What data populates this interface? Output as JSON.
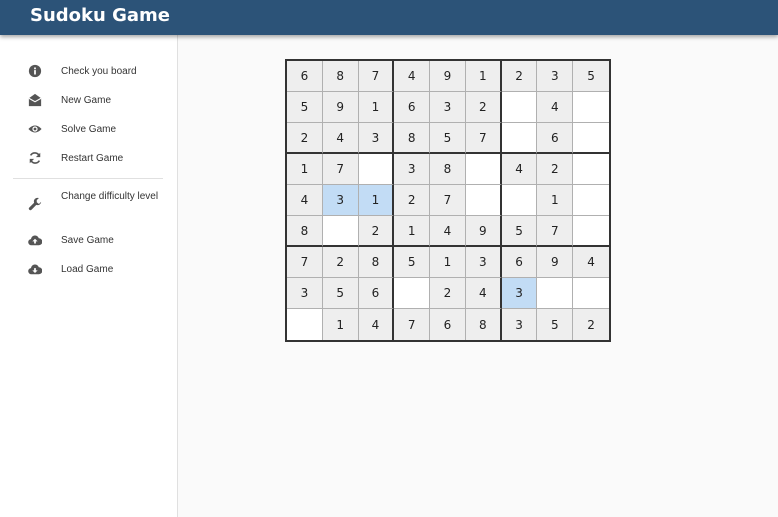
{
  "app": {
    "title": "Sudoku Game"
  },
  "sidebar": {
    "items": [
      {
        "label": "Check you board",
        "icon": "info-icon"
      },
      {
        "label": "New Game",
        "icon": "envelope-open-icon"
      },
      {
        "label": "Solve Game",
        "icon": "eye-icon"
      },
      {
        "label": "Restart Game",
        "icon": "refresh-icon"
      },
      {
        "label": "Change difficulty level",
        "icon": "wrench-icon"
      },
      {
        "label": "Save Game",
        "icon": "cloud-upload-icon"
      },
      {
        "label": "Load Game",
        "icon": "cloud-download-icon"
      }
    ]
  },
  "colors": {
    "appbar": "#2c5378",
    "given_cell": "#eeeeee",
    "selected_cell": "#c2dcf5"
  },
  "board": {
    "rows": [
      [
        "6",
        "8",
        "7",
        "4",
        "9",
        "1",
        "2",
        "3",
        "5"
      ],
      [
        "5",
        "9",
        "1",
        "6",
        "3",
        "2",
        "",
        "4",
        ""
      ],
      [
        "2",
        "4",
        "3",
        "8",
        "5",
        "7",
        "",
        "6",
        ""
      ],
      [
        "1",
        "7",
        "",
        "3",
        "8",
        "",
        "4",
        "2",
        ""
      ],
      [
        "4",
        "3",
        "1",
        "2",
        "7",
        "",
        "",
        "1",
        ""
      ],
      [
        "8",
        "",
        "2",
        "1",
        "4",
        "9",
        "5",
        "7",
        ""
      ],
      [
        "7",
        "2",
        "8",
        "5",
        "1",
        "3",
        "6",
        "9",
        "4"
      ],
      [
        "3",
        "5",
        "6",
        "",
        "2",
        "4",
        "3",
        "",
        ""
      ],
      [
        "",
        "1",
        "4",
        "7",
        "6",
        "8",
        "3",
        "5",
        "2"
      ]
    ],
    "given": [
      [
        1,
        1,
        1,
        1,
        1,
        1,
        1,
        1,
        1
      ],
      [
        1,
        1,
        1,
        1,
        1,
        1,
        0,
        1,
        0
      ],
      [
        1,
        1,
        1,
        1,
        1,
        1,
        0,
        1,
        0
      ],
      [
        1,
        1,
        0,
        1,
        1,
        0,
        1,
        1,
        0
      ],
      [
        1,
        1,
        1,
        1,
        1,
        0,
        0,
        1,
        0
      ],
      [
        1,
        0,
        1,
        1,
        1,
        1,
        1,
        1,
        0
      ],
      [
        1,
        1,
        1,
        1,
        1,
        1,
        1,
        1,
        1
      ],
      [
        1,
        1,
        1,
        0,
        1,
        1,
        1,
        0,
        0
      ],
      [
        0,
        1,
        1,
        1,
        1,
        1,
        1,
        1,
        1
      ]
    ],
    "selected": [
      [
        4,
        1
      ],
      [
        4,
        2
      ],
      [
        7,
        6
      ]
    ]
  }
}
